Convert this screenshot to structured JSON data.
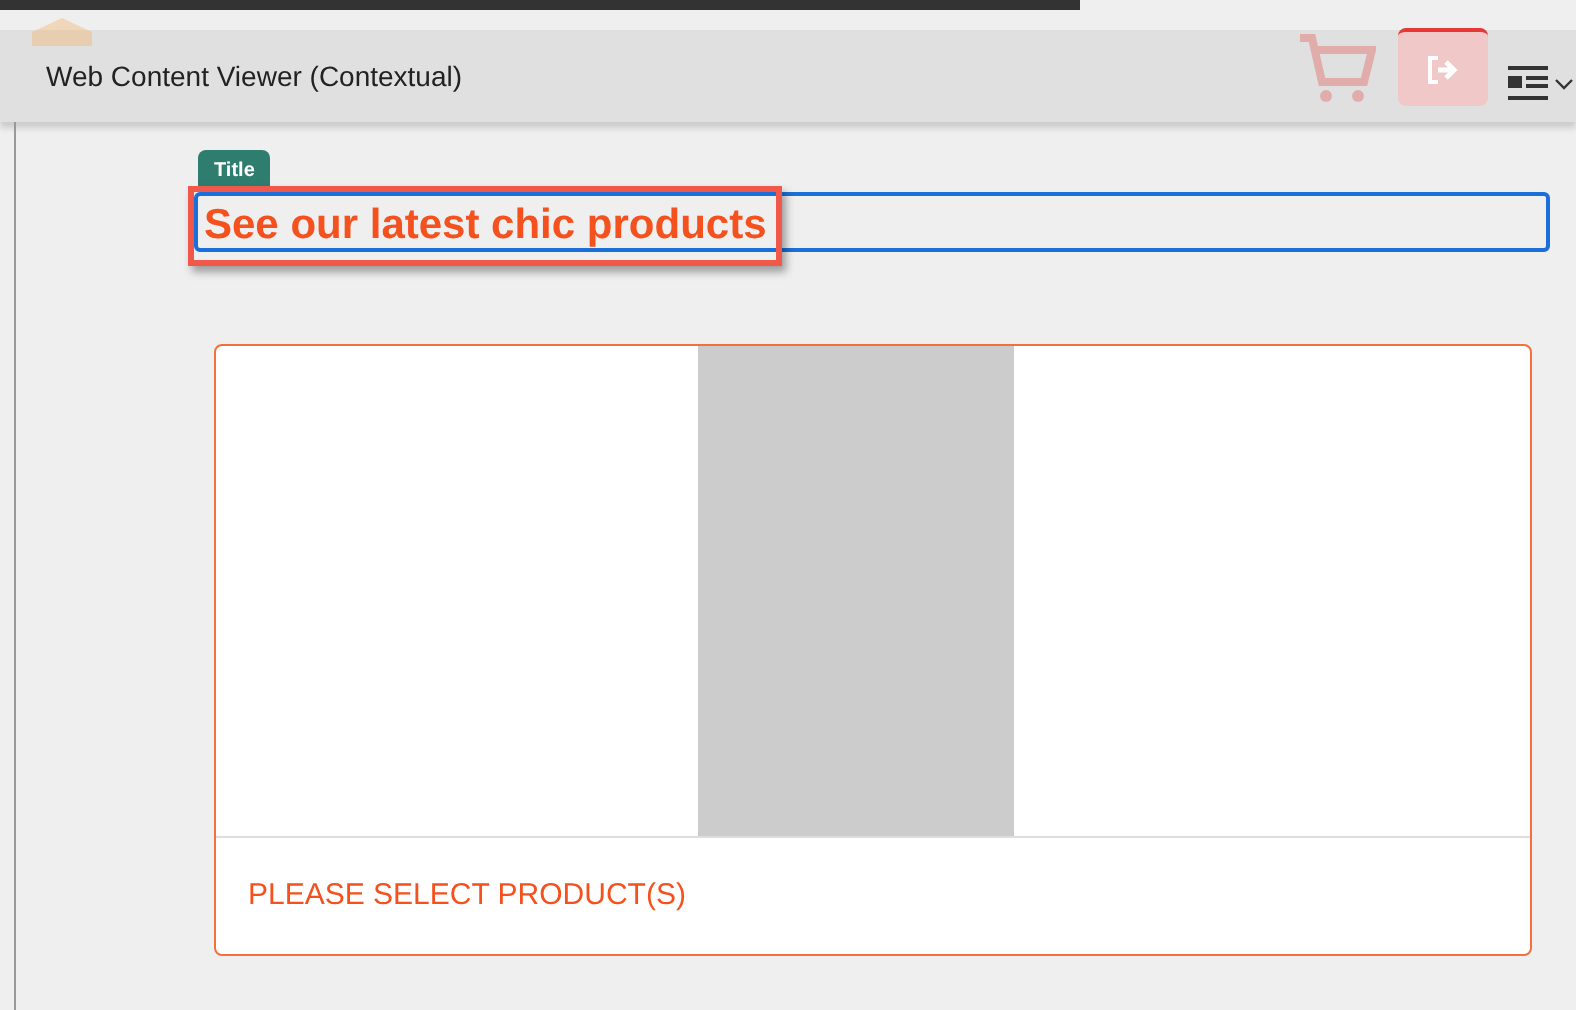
{
  "window": {
    "title": "Web Content Viewer (Contextual)"
  },
  "title_field": {
    "tag": "Title",
    "value": "See our latest chic products",
    "highlighted": true
  },
  "product_card": {
    "message": "PLEASE SELECT PRODUCT(S)"
  }
}
